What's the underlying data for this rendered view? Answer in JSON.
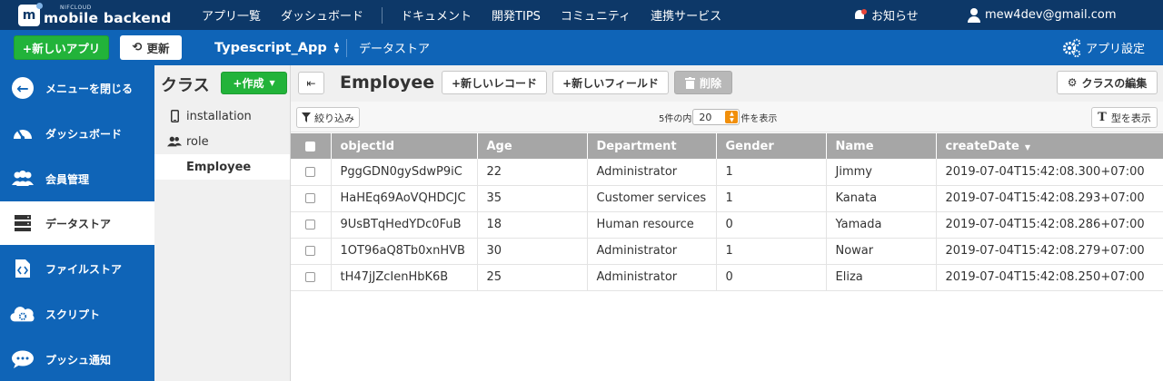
{
  "header": {
    "brand_small": "NIFCLOUD",
    "brand_name": "mobile backend",
    "nav": [
      "アプリ一覧",
      "ダッシュボード",
      "ドキュメント",
      "開発TIPS",
      "コミュニティ",
      "連携サービス"
    ],
    "notice": "お知らせ",
    "user_email": "mew4dev@gmail.com"
  },
  "appbar": {
    "new_app": "+新しいアプリ",
    "refresh": "更新",
    "app_name": "Typescript_App",
    "breadcrumb": "データストア",
    "app_settings": "アプリ設定"
  },
  "sidebar": {
    "items": [
      {
        "label": "メニューを閉じる",
        "icon": "back-arrow-icon"
      },
      {
        "label": "ダッシュボード",
        "icon": "gauge-icon"
      },
      {
        "label": "会員管理",
        "icon": "users-icon"
      },
      {
        "label": "データストア",
        "icon": "database-icon"
      },
      {
        "label": "ファイルストア",
        "icon": "file-code-icon"
      },
      {
        "label": "スクリプト",
        "icon": "cloud-gear-icon"
      },
      {
        "label": "プッシュ通知",
        "icon": "chat-bubble-icon"
      }
    ],
    "active": "データストア"
  },
  "classes": {
    "title": "クラス",
    "create": "+作成",
    "items": [
      {
        "label": "installation",
        "icon": "phone-icon"
      },
      {
        "label": "role",
        "icon": "users-icon"
      },
      {
        "label": "Employee",
        "icon": ""
      }
    ]
  },
  "toolbar": {
    "class_name": "Employee",
    "new_record": "+新しいレコード",
    "new_field": "+新しいフィールド",
    "delete": "削除",
    "edit_class": "クラスの編集"
  },
  "subbar": {
    "filter": "絞り込み",
    "count_prefix": "5件の内",
    "per_page": "20",
    "count_suffix": "件を表示",
    "show_types": "型を表示"
  },
  "table": {
    "columns": [
      "objectId",
      "Age",
      "Department",
      "Gender",
      "Name",
      "createDate"
    ],
    "sorted_column": "createDate",
    "rows": [
      [
        "PggGDN0gySdwP9iC",
        "22",
        "Administrator",
        "1",
        "Jimmy",
        "2019-07-04T15:42:08.300+07:00"
      ],
      [
        "HaHEq69AoVQHDCJC",
        "35",
        "Customer services",
        "1",
        "Kanata",
        "2019-07-04T15:42:08.293+07:00"
      ],
      [
        "9UsBTqHedYDc0FuB",
        "18",
        "Human resource",
        "0",
        "Yamada",
        "2019-07-04T15:42:08.286+07:00"
      ],
      [
        "1OT96aQ8Tb0xnHVB",
        "30",
        "Administrator",
        "1",
        "Nowar",
        "2019-07-04T15:42:08.279+07:00"
      ],
      [
        "tH47jJZcIenHbK6B",
        "25",
        "Administrator",
        "0",
        "Eliza",
        "2019-07-04T15:42:08.250+07:00"
      ]
    ]
  },
  "colors": {
    "topbar": "#0d3868",
    "appbar": "#0f64b7",
    "green": "#22b33a",
    "header_gray": "#a6a6a6"
  }
}
